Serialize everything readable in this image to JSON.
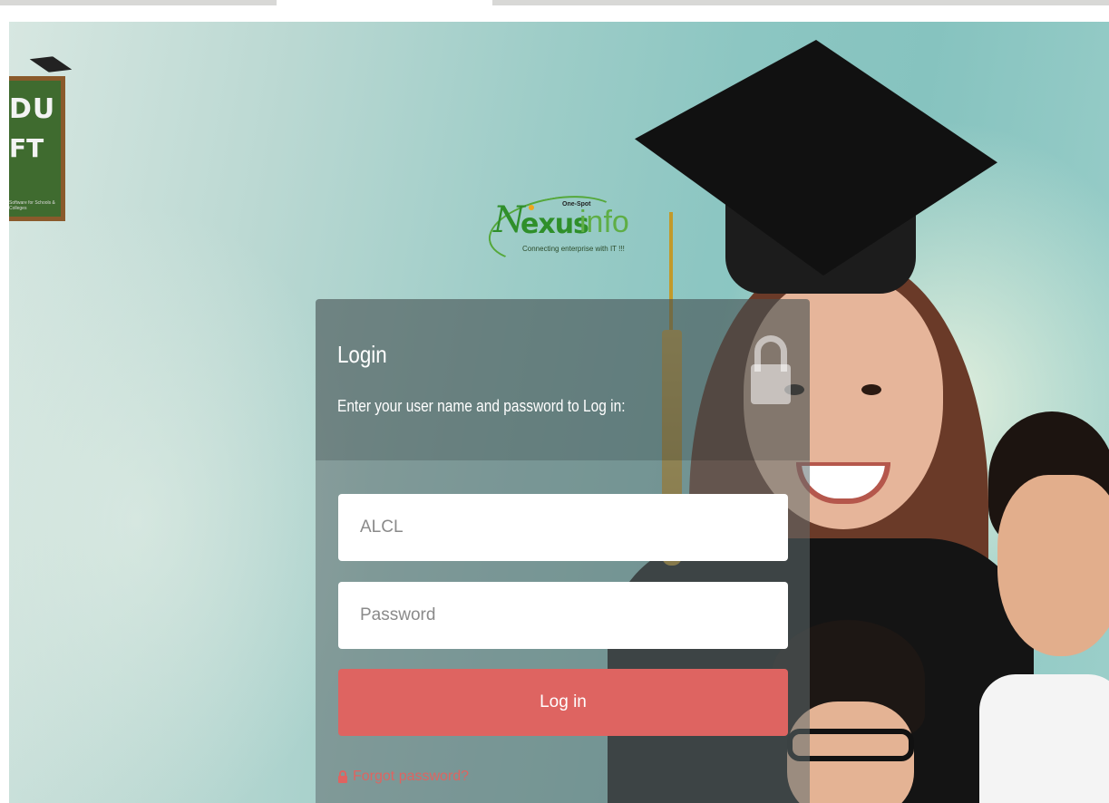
{
  "brand": {
    "name_n": "N",
    "name_exus": "exus",
    "name_info": "info",
    "badge": "One-Spot",
    "tagline": "Connecting enterprise with IT !!!"
  },
  "side_logo": {
    "line1": "DU",
    "line2": "FT",
    "small_text": "Software for Schools & Colleges"
  },
  "login": {
    "title": "Login",
    "subtitle": "Enter your user name and password to Log in:",
    "username_value": "",
    "username_placeholder": "ALCL",
    "password_placeholder": "Password",
    "submit_label": "Log in",
    "forgot_label": "Forgot password?"
  },
  "colors": {
    "accent": "#de6461",
    "brand_green": "#2f8f2a",
    "background": "#8cc6c2"
  },
  "icons": [
    "lock-icon",
    "small-lock-icon"
  ]
}
